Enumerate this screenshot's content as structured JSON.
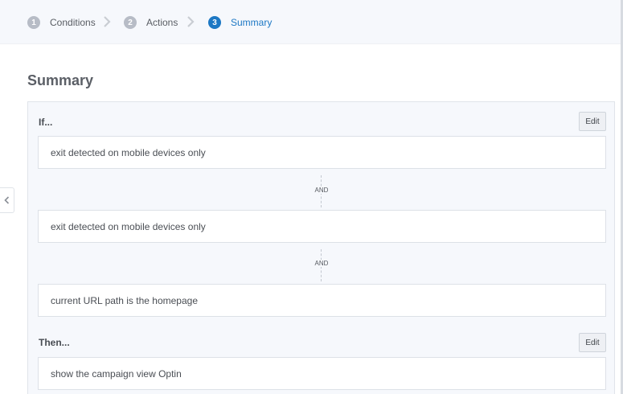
{
  "stepper": {
    "steps": [
      {
        "number": "1",
        "label": "Conditions",
        "active": false
      },
      {
        "number": "2",
        "label": "Actions",
        "active": false
      },
      {
        "number": "3",
        "label": "Summary",
        "active": true
      }
    ],
    "separator_icon": "chevron-right-icon",
    "active_color": "#1d78c4"
  },
  "summary": {
    "title": "Summary",
    "if_label": "If...",
    "then_label": "Then...",
    "edit_label": "Edit",
    "conditions": [
      "exit detected on mobile devices only",
      "exit detected on mobile devices only",
      "current URL path is the homepage"
    ],
    "connector_label": "AND",
    "actions": [
      "show the campaign view Optin"
    ]
  },
  "sidebar_toggle_icon": "chevron-left-icon"
}
